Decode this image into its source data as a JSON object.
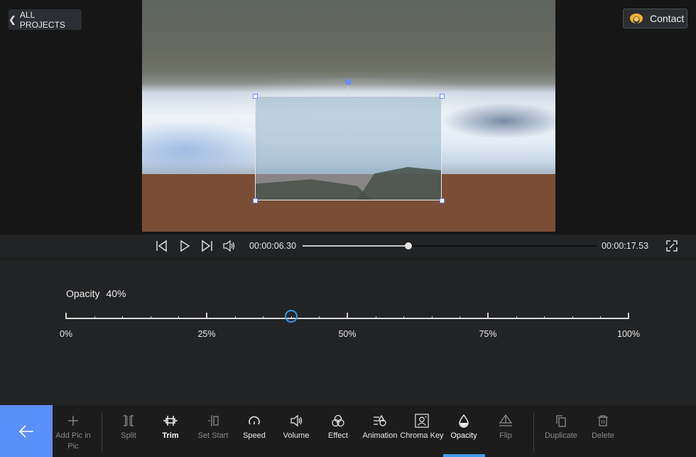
{
  "header": {
    "back_label": "ALL PROJECTS",
    "contact_label": "Contact"
  },
  "player": {
    "current_time": "00:00:06.30",
    "total_time": "00:00:17.53",
    "progress_fraction": 0.36,
    "icons": [
      "skip-back-icon",
      "play-icon",
      "skip-forward-icon",
      "volume-icon",
      "fullscreen-icon"
    ]
  },
  "opacity": {
    "label": "Opacity",
    "value_text": "40%",
    "value_percent": 40,
    "ticks": [
      "0%",
      "25%",
      "50%",
      "75%",
      "100%"
    ],
    "accent_color": "#27a0e6"
  },
  "toolbar": {
    "back_color": "#5b8ff9",
    "items": [
      {
        "label": "Add Pic in Pic",
        "icon": "plus-icon",
        "state": "dim"
      },
      {
        "label": "Split",
        "icon": "split-icon",
        "state": "dim"
      },
      {
        "label": "Trim",
        "icon": "trim-icon",
        "state": "bold"
      },
      {
        "label": "Set Start",
        "icon": "set-start-icon",
        "state": "dim"
      },
      {
        "label": "Speed",
        "icon": "speed-icon",
        "state": "bright"
      },
      {
        "label": "Volume",
        "icon": "volume-icon",
        "state": "bright"
      },
      {
        "label": "Effect",
        "icon": "effect-icon",
        "state": "bright"
      },
      {
        "label": "Animation",
        "icon": "animation-icon",
        "state": "bright"
      },
      {
        "label": "Chroma Key",
        "icon": "chroma-key-icon",
        "state": "bright"
      },
      {
        "label": "Opacity",
        "icon": "opacity-icon",
        "state": "active"
      },
      {
        "label": "Flip",
        "icon": "flip-icon",
        "state": "dim"
      },
      {
        "label": "Duplicate",
        "icon": "duplicate-icon",
        "state": "dim"
      },
      {
        "label": "Delete",
        "icon": "delete-icon",
        "state": "dim"
      }
    ]
  }
}
